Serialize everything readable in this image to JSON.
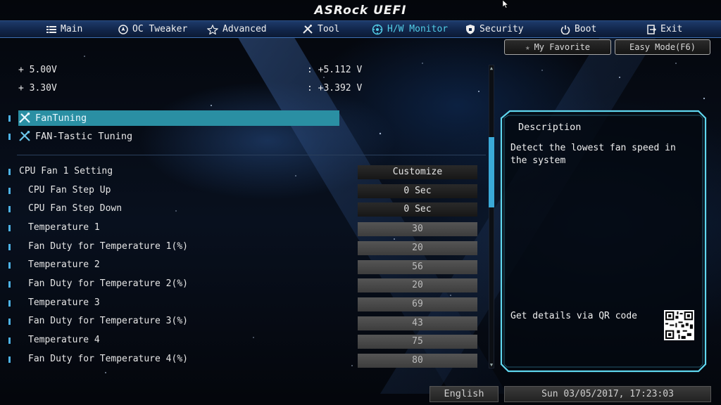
{
  "brand": "ASRock UEFI",
  "nav": {
    "tabs": [
      {
        "label": "Main",
        "icon": "list-icon"
      },
      {
        "label": "OC Tweaker",
        "icon": "rocket-icon"
      },
      {
        "label": "Advanced",
        "icon": "star-icon"
      },
      {
        "label": "Tool",
        "icon": "tools-icon"
      },
      {
        "label": "H/W Monitor",
        "icon": "monitor-icon",
        "active": true
      },
      {
        "label": "Security",
        "icon": "shield-icon"
      },
      {
        "label": "Boot",
        "icon": "power-icon"
      },
      {
        "label": "Exit",
        "icon": "exit-icon"
      }
    ]
  },
  "buttons": {
    "favorite": "My Favorite",
    "easy_mode": "Easy Mode(F6)"
  },
  "voltages": [
    {
      "label": "+ 5.00V",
      "value": ": +5.112 V"
    },
    {
      "label": "+ 3.30V",
      "value": ": +3.392 V"
    }
  ],
  "menu": [
    {
      "label": "FanTuning",
      "selected": true
    },
    {
      "label": "FAN-Tastic Tuning",
      "selected": false
    }
  ],
  "settings": [
    {
      "label": "CPU Fan 1 Setting",
      "value": "Customize",
      "style": "dark"
    },
    {
      "label": "CPU Fan Step Up",
      "value": "0 Sec",
      "style": "dark"
    },
    {
      "label": "CPU Fan Step Down",
      "value": "0 Sec",
      "style": "dark"
    },
    {
      "label": "Temperature 1",
      "value": "30",
      "style": "light"
    },
    {
      "label": "Fan Duty for Temperature 1(%)",
      "value": "20",
      "style": "light"
    },
    {
      "label": "Temperature 2",
      "value": "56",
      "style": "light"
    },
    {
      "label": "Fan Duty for Temperature 2(%)",
      "value": "20",
      "style": "light"
    },
    {
      "label": "Temperature 3",
      "value": "69",
      "style": "light"
    },
    {
      "label": "Fan Duty for Temperature 3(%)",
      "value": "43",
      "style": "light"
    },
    {
      "label": "Temperature 4",
      "value": "75",
      "style": "light"
    },
    {
      "label": "Fan Duty for Temperature 4(%)",
      "value": "80",
      "style": "light"
    }
  ],
  "description": {
    "title": "Description",
    "text": "Detect the lowest fan speed in the system",
    "qr_text": "Get details via QR code"
  },
  "footer": {
    "language": "English",
    "datetime": "Sun 03/05/2017, 17:23:03"
  },
  "colors": {
    "accent": "#52cde6",
    "selection": "#2a8fa3",
    "nav_bg": "#102447"
  }
}
